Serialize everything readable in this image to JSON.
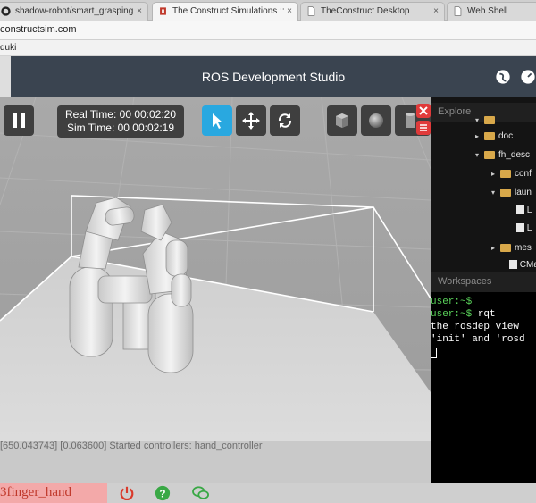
{
  "browser": {
    "tabs": [
      {
        "label": "shadow-robot/smart_grasping",
        "icon": "github-icon",
        "active": false
      },
      {
        "label": "The Construct Simulations ::",
        "icon": "construct-icon",
        "active": true
      },
      {
        "label": "TheConstruct Desktop",
        "icon": "page-icon",
        "active": false
      },
      {
        "label": "Web Shell",
        "icon": "page-icon",
        "active": false
      }
    ],
    "url": "constructsim.com",
    "bookmark": "duki"
  },
  "app": {
    "title": "ROS Development Studio"
  },
  "sim": {
    "real_time": "Real Time: 00 00:02:20",
    "sim_time": "Sim Time: 00 00:02:19",
    "log": "[650.043743] [0.063600] Started controllers: hand_controller"
  },
  "explore": {
    "title": "Explore",
    "items": [
      {
        "label": "",
        "type": "folder"
      },
      {
        "label": "doc",
        "type": "folder"
      },
      {
        "label": "fh_desc",
        "type": "folder"
      },
      {
        "label": "conf",
        "type": "folder"
      },
      {
        "label": "laun",
        "type": "folder"
      },
      {
        "label": "L",
        "type": "file"
      },
      {
        "label": "L",
        "type": "file"
      },
      {
        "label": "mes",
        "type": "folder"
      },
      {
        "label": "CMa",
        "type": "file"
      }
    ]
  },
  "workspaces": {
    "title": "Workspaces",
    "prompt": "user:~$",
    "cmd": " rqt",
    "line1": "the rosdep view",
    "line2": "'init' and 'rosd"
  },
  "bottom": {
    "robot_name": "3finger_hand"
  },
  "colors": {
    "accent_blue": "#29a8e0",
    "close_red": "#e03a3a",
    "power_red": "#d93a2b",
    "help_green": "#39a845",
    "header_bg": "#3a4450"
  }
}
